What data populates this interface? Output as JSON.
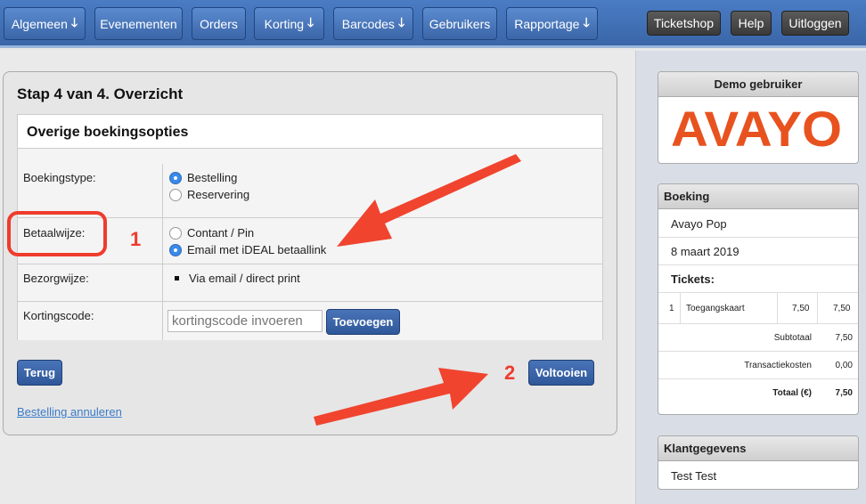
{
  "nav": {
    "left": [
      {
        "label": "Algemeen",
        "dropdown": true
      },
      {
        "label": "Evenementen",
        "dropdown": false
      },
      {
        "label": "Orders",
        "dropdown": false
      },
      {
        "label": "Korting",
        "dropdown": true
      },
      {
        "label": "Barcodes",
        "dropdown": true
      },
      {
        "label": "Gebruikers",
        "dropdown": false
      },
      {
        "label": "Rapportage",
        "dropdown": true
      }
    ],
    "right": [
      {
        "label": "Ticketshop"
      },
      {
        "label": "Help"
      },
      {
        "label": "Uitloggen"
      }
    ],
    "dropdown_glyph": "🡓"
  },
  "main": {
    "title": "Stap 4 van 4. Overzicht",
    "panel_title": "Overige boekingsopties",
    "boekingstype": {
      "label": "Boekingstype:",
      "options": [
        {
          "label": "Bestelling",
          "selected": true
        },
        {
          "label": "Reservering",
          "selected": false
        }
      ]
    },
    "betaalwijze": {
      "label": "Betaalwijze:",
      "options": [
        {
          "label": "Contant / Pin",
          "selected": false
        },
        {
          "label": "Email met iDEAL betaallink",
          "selected": true
        }
      ]
    },
    "bezorgwijze": {
      "label": "Bezorgwijze:",
      "value": "Via email / direct print"
    },
    "kortingscode": {
      "label": "Kortingscode:",
      "placeholder": "kortingscode invoeren",
      "button": "Toevoegen"
    },
    "back_button": "Terug",
    "finish_button": "Voltooien",
    "cancel_link": "Bestelling annuleren"
  },
  "annotations": {
    "num1": "1",
    "num2": "2"
  },
  "sidebar": {
    "user_title": "Demo gebruiker",
    "logo_text": "AVAYO",
    "booking": {
      "title": "Boeking",
      "event": "Avayo Pop",
      "date": "8 maart 2019",
      "tickets_label": "Tickets:",
      "line": {
        "qty": "1",
        "name": "Toegangskaart",
        "price": "7,50",
        "total": "7,50"
      },
      "subtotal_label": "Subtotaal",
      "subtotal": "7,50",
      "fee_label": "Transactiekosten",
      "fee": "0,00",
      "total_label": "Totaal (€)",
      "total": "7,50"
    },
    "customer": {
      "title": "Klantgegevens",
      "name": "Test Test"
    }
  },
  "colors": {
    "accent": "#3b66a8",
    "annotation": "#ef3b2d",
    "logo": "#e8521f"
  }
}
